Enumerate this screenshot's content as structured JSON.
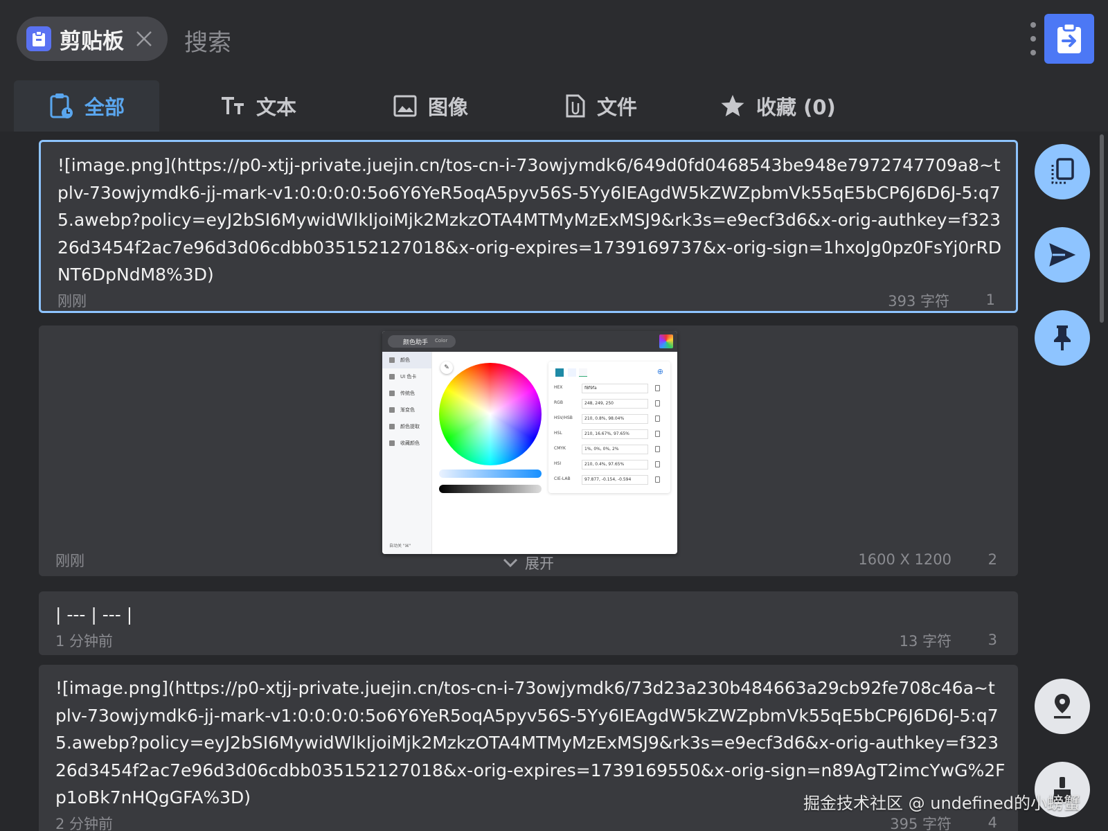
{
  "header": {
    "chip_label": "剪贴板",
    "search_placeholder": "搜索"
  },
  "tabs": [
    {
      "label": "全部",
      "icon": "clipboard-clock-icon",
      "active": true
    },
    {
      "label": "文本",
      "icon": "text-size-icon"
    },
    {
      "label": "图像",
      "icon": "image-icon"
    },
    {
      "label": "文件",
      "icon": "file-clip-icon"
    },
    {
      "label": "收藏 (0)",
      "icon": "star-icon"
    }
  ],
  "items": [
    {
      "text": "![image.png](https://p0-xtjj-private.juejin.cn/tos-cn-i-73owjymdk6/649d0fd0468543be948e7972747709a8~tplv-73owjymdk6-jj-mark-v1:0:0:0:0:5o6Y6YeR5oqA5pyv56S-5Yy6IEAgdW5kZWZpbmVk55qE5bCP6J6D6J-5:q75.awebp?policy=eyJ2bSI6MywidWlkIjoiMjk2MzkzOTA4MTMyMzExMSJ9&rk3s=e9ecf3d6&x-orig-authkey=f32326d3454f2ac7e96d3d06cdbb035152127018&x-orig-expires=1739169737&x-orig-sign=1hxoJg0pz0FsYj0rRDNT6DpNdM8%3D)",
      "time": "刚刚",
      "meta": "393 字符",
      "index": "1"
    },
    {
      "time": "刚刚",
      "meta": "1600 X 1200",
      "index": "2",
      "expand": "展开",
      "thumb": {
        "chip_label": "颜色助手",
        "chip_sub": "Color",
        "sidebar": [
          "颜色",
          "UI 色卡",
          "传统色",
          "渐变色",
          "颜色提取",
          "收藏颜色"
        ],
        "footer": "自动关 \"⌘\"",
        "rows": [
          {
            "k": "HEX",
            "v": "f8f9fa"
          },
          {
            "k": "RGB",
            "v": "248, 249, 250"
          },
          {
            "k": "HSV/HSB",
            "v": "210, 0.8%, 98.04%"
          },
          {
            "k": "HSL",
            "v": "210, 16.67%, 97.65%"
          },
          {
            "k": "CMYK",
            "v": "1%, 0%, 0%, 2%"
          },
          {
            "k": "HSI",
            "v": "210, 0.4%, 97.65%"
          },
          {
            "k": "CIE-LAB",
            "v": "97.877, -0.154, -0.594"
          }
        ]
      }
    },
    {
      "text": "| --- | --- |",
      "time": "1 分钟前",
      "meta": "13 字符",
      "index": "3"
    },
    {
      "text": "![image.png](https://p0-xtjj-private.juejin.cn/tos-cn-i-73owjymdk6/73d23a230b484663a29cb92fe708c46a~tplv-73owjymdk6-jj-mark-v1:0:0:0:0:5o6Y6YeR5oqA5pyv56S-5Yy6IEAgdW5kZWZpbmVk55qE5bCP6J6D6J-5:q75.awebp?policy=eyJ2bSI6MywidWlkIjoiMjk2MzkzOTA4MTMyMzExMSJ9&rk3s=e9ecf3d6&x-orig-authkey=f32326d3454f2ac7e96d3d06cdbb035152127018&x-orig-expires=1739169550&x-orig-sign=n89AgT2imcYwG%2Fp1oBk7nHQgGFA%3D)",
      "time": "2 分钟前",
      "meta": "395 字符",
      "index": "4"
    }
  ],
  "watermark": "掘金技术社区 @ undefined的小螃蟹",
  "colors": {
    "accent": "#5aa6ee",
    "fab_blue": "#8ec4ff",
    "paste_button": "#4c78f5",
    "selected_border": "#8ec4ff"
  }
}
